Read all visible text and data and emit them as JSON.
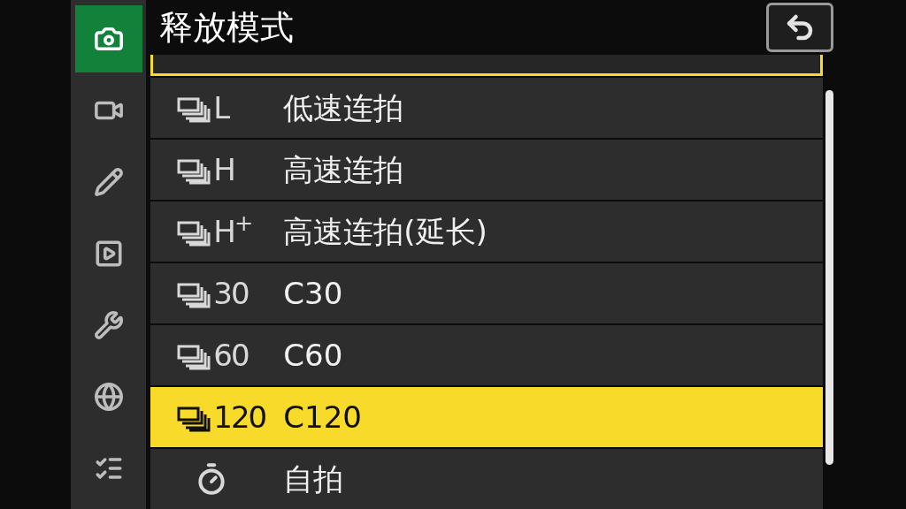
{
  "sidebar": {
    "items": [
      {
        "kind": "photo",
        "selected": true
      },
      {
        "kind": "movie",
        "selected": false
      },
      {
        "kind": "custom",
        "selected": false
      },
      {
        "kind": "playback",
        "selected": false
      },
      {
        "kind": "setup",
        "selected": false
      },
      {
        "kind": "network",
        "selected": false
      },
      {
        "kind": "mymenu",
        "selected": false
      }
    ]
  },
  "title": "释放模式",
  "list": {
    "partial_row_selected": false,
    "items": [
      {
        "kind": "burst",
        "code": "L",
        "label": "低速连拍",
        "selected": false
      },
      {
        "kind": "burst",
        "code": "H",
        "label": "高速连拍",
        "selected": false
      },
      {
        "kind": "burst",
        "code": "H$^{+}$",
        "label": "高速连拍(延长)",
        "selected": false
      },
      {
        "kind": "burst",
        "code": "30",
        "label": "C30",
        "selected": false
      },
      {
        "kind": "burst",
        "code": "60",
        "label": "C60",
        "selected": false
      },
      {
        "kind": "burst",
        "code": "120",
        "label": "C120",
        "selected": true
      },
      {
        "kind": "timer",
        "label": "自拍",
        "selected": false
      }
    ]
  }
}
